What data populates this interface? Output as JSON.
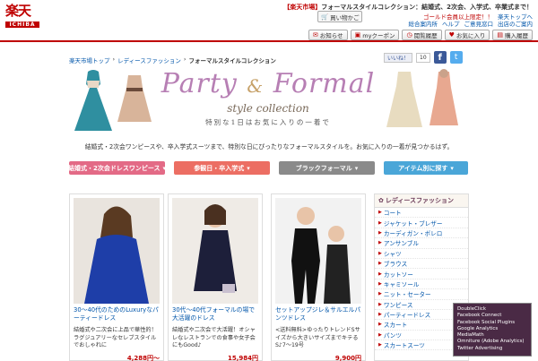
{
  "header": {
    "logo_text": "楽天",
    "logo_sub": "ICHIBA",
    "promo_store": "【楽天市場】",
    "promo_text": "フォーマルスタイルコレクション：結婚式、2次会、入学式、卒業式まで！",
    "cart_label": "買い物かご",
    "links_row1": [
      "ゴールド会員以上限定！！",
      "楽天トップへ"
    ],
    "links_row2": [
      "総合案内所",
      "ヘルプ",
      "ご意見窓口",
      "出店のご案内"
    ],
    "nav": [
      "お知らせ",
      "myクーポン",
      "閲覧履歴",
      "お気に入り",
      "購入履歴"
    ]
  },
  "breadcrumb": [
    "楽天市場トップ",
    "レディースファッション",
    "フォーマルスタイルコレクション"
  ],
  "social": {
    "like_label": "いいね！",
    "like_count": "10",
    "fb": "f",
    "tw": "t"
  },
  "banner": {
    "title_part1": "Party",
    "title_amp": "&",
    "title_part2": "Formal",
    "subtitle": "style collection",
    "tagline": "特別な1日はお気に入りの一着で"
  },
  "intro": "結婚式・2次会ワンピースや、卒入学式スーツまで、特別な日にぴったりなフォーマルスタイルを。お気に入りの一着が見つかるはず。",
  "categories": [
    {
      "label": "結婚式・2次会ドレスワンピース",
      "color": "#e36a86"
    },
    {
      "label": "参観日・卒入学式",
      "color": "#ec6e63"
    },
    {
      "label": "ブラックフォーマル",
      "color": "#8a8a8a"
    },
    {
      "label": "アイテム別に探す",
      "color": "#4aa6d8"
    }
  ],
  "products": [
    {
      "title": "30〜40代のためのLuxuryなパーティードレス",
      "desc": "結婚式や二次会に上品で華性的！ラグジュアリーなセレブスタイルでおしゃれに",
      "price": "4,288円〜"
    },
    {
      "title": "30代〜40代フォーマルの場で大活躍のドレス",
      "desc": "結婚式や二次会で大活躍！オシャレなレストランでの食事や女子会にもGood♪",
      "price": "15,984円"
    },
    {
      "title": "セットアップジレ＆サルエルパンツドレス",
      "desc": "<送料無料>ゆったりトレンドSサイズから大きいサイズまでキテるS♪7〜19号",
      "price": "9,900円"
    }
  ],
  "sidebar": {
    "heading": "レディースファッション",
    "items": [
      "コート",
      "ジャケット・ブレザー",
      "カーディガン・ボレロ",
      "アンサンブル",
      "シャツ",
      "ブラウス",
      "カットソー",
      "キャミソール",
      "ニット・セーター",
      "ワンピース",
      "パーティードレス",
      "スカート",
      "パンツ",
      "スカートスーツ"
    ]
  },
  "tracker": [
    "DoubleClick",
    "Facebook Connect",
    "Facebook Social Plugins",
    "Google Analytics",
    "MediaMath",
    "Omniture (Adobe Analytics)",
    "Twitter Advertising"
  ],
  "colors": {
    "brand": "#bf0000",
    "link": "#0055aa",
    "banner_title": "#b77fb4"
  }
}
